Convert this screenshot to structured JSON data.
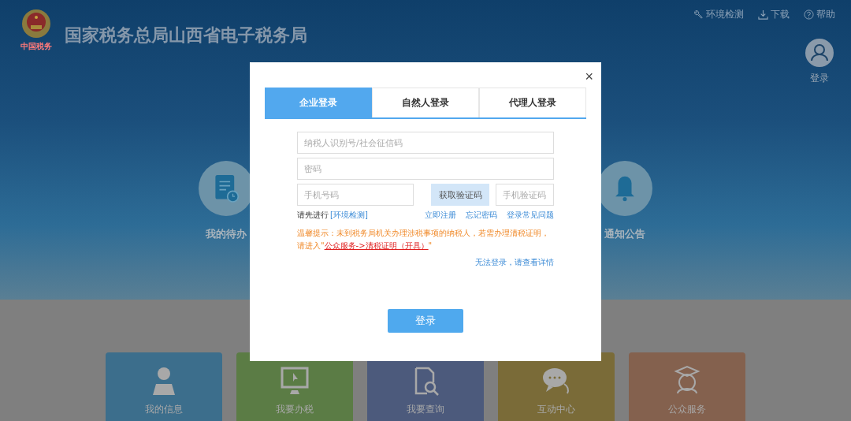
{
  "header": {
    "title": "国家税务总局山西省电子税务局",
    "emblem_caption": "中国税务",
    "links": [
      {
        "kind": "wrench",
        "label": "环境检测"
      },
      {
        "kind": "download",
        "label": "下载"
      },
      {
        "kind": "help",
        "label": "帮助"
      }
    ],
    "user": {
      "label": "登录"
    }
  },
  "hero_features": [
    {
      "kind": "todo",
      "label": "我的待办"
    },
    {
      "kind": "bell",
      "label": "通知公告"
    }
  ],
  "tiles": [
    {
      "kind": "person",
      "label": "我的信息",
      "color": "#3c6e8c"
    },
    {
      "kind": "monitor",
      "label": "我要办税",
      "color": "#5b7c45"
    },
    {
      "kind": "search-doc",
      "label": "我要查询",
      "color": "#4c5a7c"
    },
    {
      "kind": "chat",
      "label": "互动中心",
      "color": "#7a6b38"
    },
    {
      "kind": "service",
      "label": "公众服务",
      "color": "#84614e"
    }
  ],
  "dialog": {
    "close": "×",
    "tabs": [
      {
        "label": "企业登录",
        "selected": true
      },
      {
        "label": "自然人登录",
        "selected": false
      },
      {
        "label": "代理人登录",
        "selected": false
      }
    ],
    "taxpayer_id": {
      "placeholder": "纳税人识别号/社会征信码"
    },
    "password": {
      "placeholder": "密码"
    },
    "phone": {
      "placeholder": "手机号码"
    },
    "get_code_button": "获取验证码",
    "sms_code": {
      "placeholder": "手机验证码"
    },
    "env_prompt": "请先进行",
    "env_link": "[环境检测]",
    "links": [
      "立即注册",
      "忘记密码",
      "登录常见问题"
    ],
    "notice": "温馨提示：未到税务局机关办理涉税事项的纳税人，若需办理清税证明，请进入\"",
    "notice_link": "公众服务->清税证明（开具）",
    "notice_end": "\"",
    "help_link": "无法登录，请查看详情",
    "login_button": "登录"
  }
}
